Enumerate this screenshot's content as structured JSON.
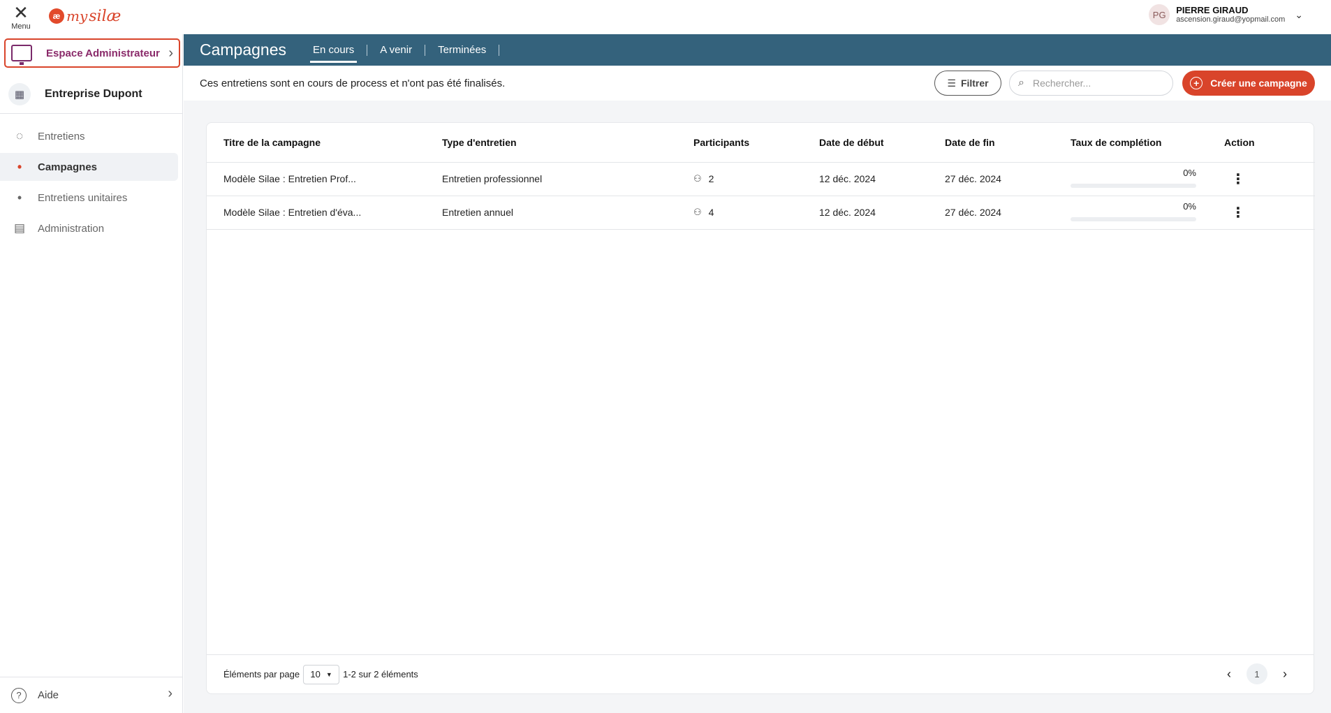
{
  "topbar": {
    "menu_label": "Menu",
    "logo_mark": "æ",
    "logo_word1": "my",
    "logo_word2": "silæ",
    "user": {
      "initials": "PG",
      "name": "PIERRE GIRAUD",
      "email": "ascension.giraud@yopmail.com"
    }
  },
  "sidebar": {
    "admin_space": "Espace Administrateur",
    "company": "Entreprise Dupont",
    "items": [
      {
        "label": "Entretiens",
        "icon": "chat-icon"
      },
      {
        "label": "Campagnes",
        "icon": "dot"
      },
      {
        "label": "Entretiens unitaires",
        "icon": "dot"
      },
      {
        "label": "Administration",
        "icon": "admin-icon"
      }
    ],
    "help": "Aide"
  },
  "header": {
    "title": "Campagnes",
    "tabs": [
      "En cours",
      "A venir",
      "Terminées"
    ]
  },
  "subbar": {
    "description": "Ces entretiens sont en cours de process et n'ont pas été finalisés.",
    "filter_label": "Filtrer",
    "search_placeholder": "Rechercher...",
    "create_label": "Créer une campagne"
  },
  "table": {
    "headers": [
      "Titre de la campagne",
      "Type d'entretien",
      "Participants",
      "Date de début",
      "Date de fin",
      "Taux de complétion",
      "Action"
    ],
    "rows": [
      {
        "title": "Modèle Silae : Entretien Prof...",
        "type": "Entretien professionnel",
        "participants": "2",
        "start": "12 déc. 2024",
        "end": "27 déc. 2024",
        "completion": "0%",
        "completion_value": 0
      },
      {
        "title": "Modèle Silae : Entretien d'éva...",
        "type": "Entretien annuel",
        "participants": "4",
        "start": "12 déc. 2024",
        "end": "27 déc. 2024",
        "completion": "0%",
        "completion_value": 0
      }
    ]
  },
  "footer": {
    "per_page_label": "Éléments par page",
    "per_page_value": "10",
    "range_text": "1-2 sur 2 éléments",
    "current_page": "1"
  },
  "colors": {
    "accent": "#d9442a",
    "header_band": "#34627c",
    "admin_purple": "#8a2a6a"
  }
}
